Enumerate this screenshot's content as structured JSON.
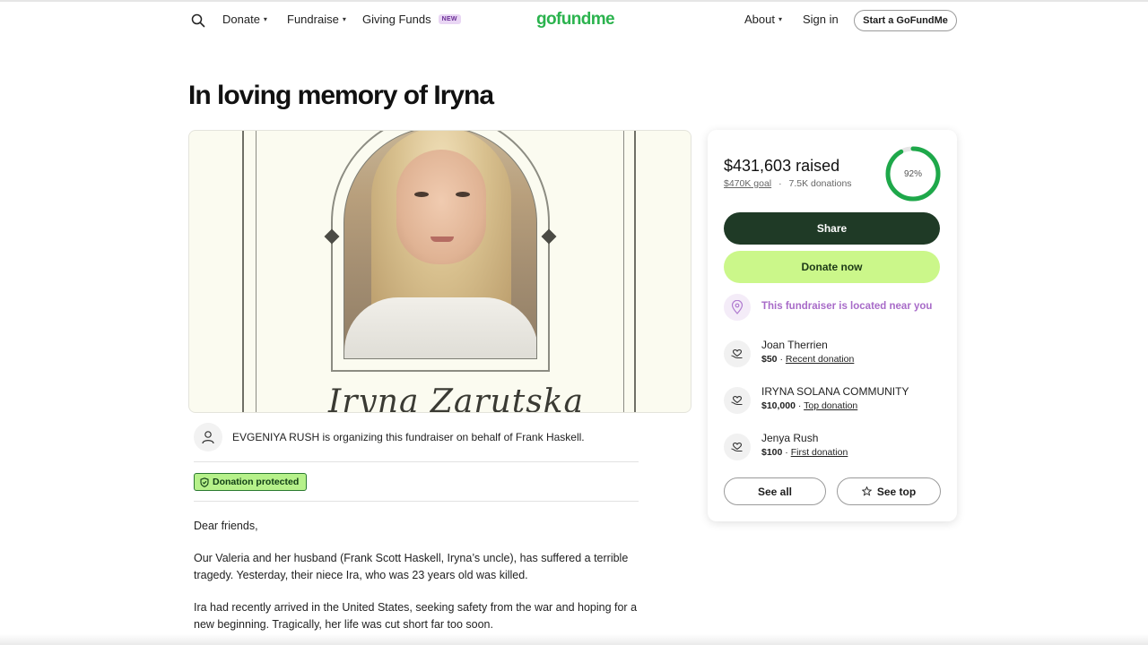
{
  "header": {
    "search_icon": "search-icon",
    "nav": [
      {
        "label": "Donate",
        "caret": "▾"
      },
      {
        "label": "Fundraise",
        "caret": "▾"
      },
      {
        "label": "Giving Funds",
        "badge": "NEW"
      }
    ],
    "logo": "gofundme",
    "right_nav": [
      {
        "label": "About",
        "caret": "▾"
      },
      {
        "label": "Sign in"
      }
    ],
    "start_button": "Start a GoFundMe"
  },
  "page": {
    "title": "In loving memory of Iryna"
  },
  "hero": {
    "name_text": "Iryna Zarutska"
  },
  "organizer": {
    "text": "EVGENIYA RUSH is organizing this fundraiser on behalf of Frank Haskell."
  },
  "badge": {
    "label": "Donation protected"
  },
  "story": {
    "paragraphs": [
      "Dear friends,",
      "Our Valeria and her husband (Frank Scott Haskell, Iryna’s uncle), has suffered a terrible tragedy. Yesterday, their niece Ira, who was 23 years old was killed.",
      "Ira had recently arrived in the United States, seeking safety from the war and hoping for a new beginning. Tragically, her life was cut short far too soon."
    ]
  },
  "card": {
    "raised": "$431,603 raised",
    "goal": "$470K goal",
    "separator": "·",
    "donations": "7.5K donations",
    "percent_label": "92%",
    "percent_value": 0.92,
    "share_label": "Share",
    "donate_label": "Donate now",
    "near_text": "This fundraiser is located near you",
    "donors": [
      {
        "name": "Joan Therrien",
        "amount": "$50",
        "sep": "·",
        "tag": "Recent donation"
      },
      {
        "name": "IRYNA SOLANA COMMUNITY",
        "amount": "$10,000",
        "sep": "·",
        "tag": "Top donation"
      },
      {
        "name": "Jenya Rush",
        "amount": "$100",
        "sep": "·",
        "tag": "First donation"
      }
    ],
    "see_all_label": "See all",
    "see_top_label": "See top"
  },
  "colors": {
    "brand_green": "#2bb34e",
    "share_bg": "#1f3a26",
    "donate_bg": "#cbf78a",
    "near_purple": "#a86bc8",
    "ring_green": "#1ea84a",
    "badge_green": "#b6f18a"
  }
}
